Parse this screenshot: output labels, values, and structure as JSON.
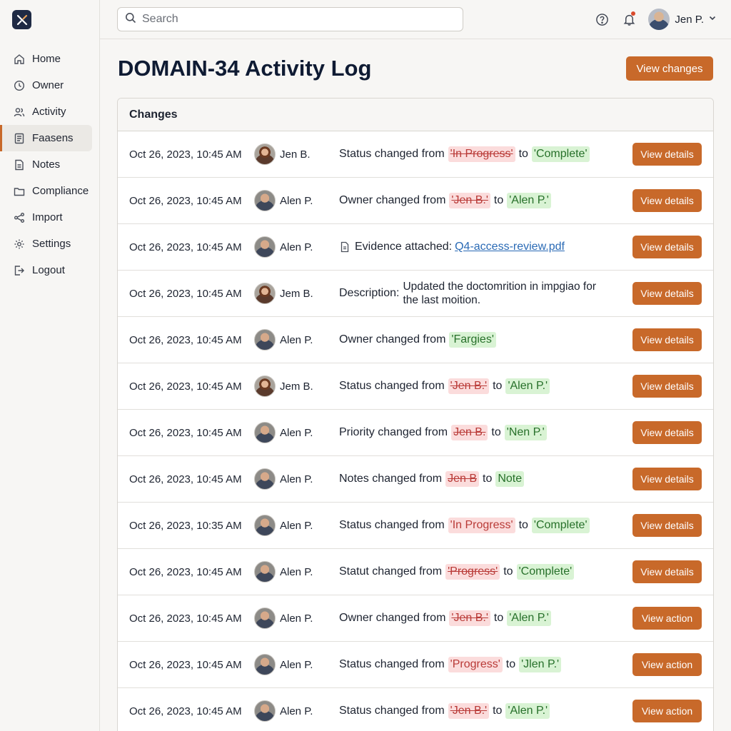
{
  "app": {
    "logo_icon": "brand-x-icon"
  },
  "sidebar": {
    "items": [
      {
        "label": "Home",
        "icon": "home-icon"
      },
      {
        "label": "Owner",
        "icon": "clock-icon"
      },
      {
        "label": "Activity",
        "icon": "users-icon"
      },
      {
        "label": "Faasens",
        "icon": "document-icon",
        "active": true
      },
      {
        "label": "Notes",
        "icon": "note-icon"
      },
      {
        "label": "Compliance",
        "icon": "folder-icon"
      },
      {
        "label": "Import",
        "icon": "share-icon"
      },
      {
        "label": "Settings",
        "icon": "gear-icon"
      },
      {
        "label": "Logout",
        "icon": "logout-icon"
      }
    ]
  },
  "topbar": {
    "search_placeholder": "Search",
    "user_name": "Jen P."
  },
  "page": {
    "title": "DOMAIN-34 Activity Log",
    "primary_button": "View changes"
  },
  "panel": {
    "title": "Changes",
    "rows": [
      {
        "timestamp": "Oct 26, 2023, 10:45 AM",
        "user": "Jen B.",
        "female": true,
        "prefix": "Status changed from",
        "old": "'In Progress'",
        "mid": "to",
        "new": "'Complete'",
        "button": "View details"
      },
      {
        "timestamp": "Oct 26, 2023, 10:45 AM",
        "user": "Alen P.",
        "prefix": "Owner changed from",
        "old": "'Jen B.'",
        "mid": "to",
        "new": "'Alen P.'",
        "button": "View details"
      },
      {
        "timestamp": "Oct 26, 2023, 10:45 AM",
        "user": "Alen P.",
        "type": "attachment",
        "prefix": "Evidence attached:",
        "link": "Q4-access-review.pdf",
        "button": "View details"
      },
      {
        "timestamp": "Oct 26, 2023, 10:45 AM",
        "user": "Jem B.",
        "female": true,
        "type": "description",
        "prefix": "Description:",
        "text": "Updated the doctomrition in imрgiao for the last moition.",
        "button": "View details"
      },
      {
        "timestamp": "Oct 26, 2023, 10:45 AM",
        "user": "Alen P.",
        "prefix": "Owner changed from",
        "new": "'Fargies'",
        "button": "View details"
      },
      {
        "timestamp": "Oct 26, 2023, 10:45 AM",
        "user": "Jem B.",
        "female": true,
        "prefix": "Status changed from",
        "old": "'Jen B.'",
        "mid": "to",
        "new": "'Alen P.'",
        "button": "View details"
      },
      {
        "timestamp": "Oct 26, 2023, 10:45 AM",
        "user": "Alen P.",
        "prefix": "Priority changed from",
        "old": "Jen B.",
        "mid": "to",
        "new": "'Nen P.'",
        "button": "View details"
      },
      {
        "timestamp": "Oct 26, 2023, 10:45 AM",
        "user": "Alen P.",
        "prefix": "Notes changed from",
        "old": "Jen B",
        "mid": "to",
        "new": "Note",
        "button": "View details"
      },
      {
        "timestamp": "Oct 26, 2023, 10:35 AM",
        "user": "Alen P.",
        "prefix": "Status changed from",
        "old": "'In Progress'",
        "old_plain": true,
        "mid": "to",
        "new": "'Complete'",
        "button": "View details"
      },
      {
        "timestamp": "Oct 26, 2023, 10:45 AM",
        "user": "Alen P.",
        "prefix": "Statut changed from",
        "old": "'Progress'",
        "mid": "to",
        "new": "'Complete'",
        "button": "View details"
      },
      {
        "timestamp": "Oct 26, 2023, 10:45 AM",
        "user": "Alen P.",
        "prefix": "Owner changed from",
        "old": "'Jen B.'",
        "mid": "to",
        "new": "'Alen P.'",
        "button": "View action"
      },
      {
        "timestamp": "Oct 26, 2023, 10:45 AM",
        "user": "Alen P.",
        "prefix": "Status changed from",
        "old": "'Progress'",
        "old_plain": true,
        "mid": "to",
        "new": "'Jlen P.'",
        "button": "View action"
      },
      {
        "timestamp": "Oct 26, 2023, 10:45 AM",
        "user": "Alen P.",
        "prefix": "Status changed from",
        "old": "'Jen B.'",
        "mid": "to",
        "new": "'Alen P.'",
        "button": "View action"
      }
    ]
  }
}
